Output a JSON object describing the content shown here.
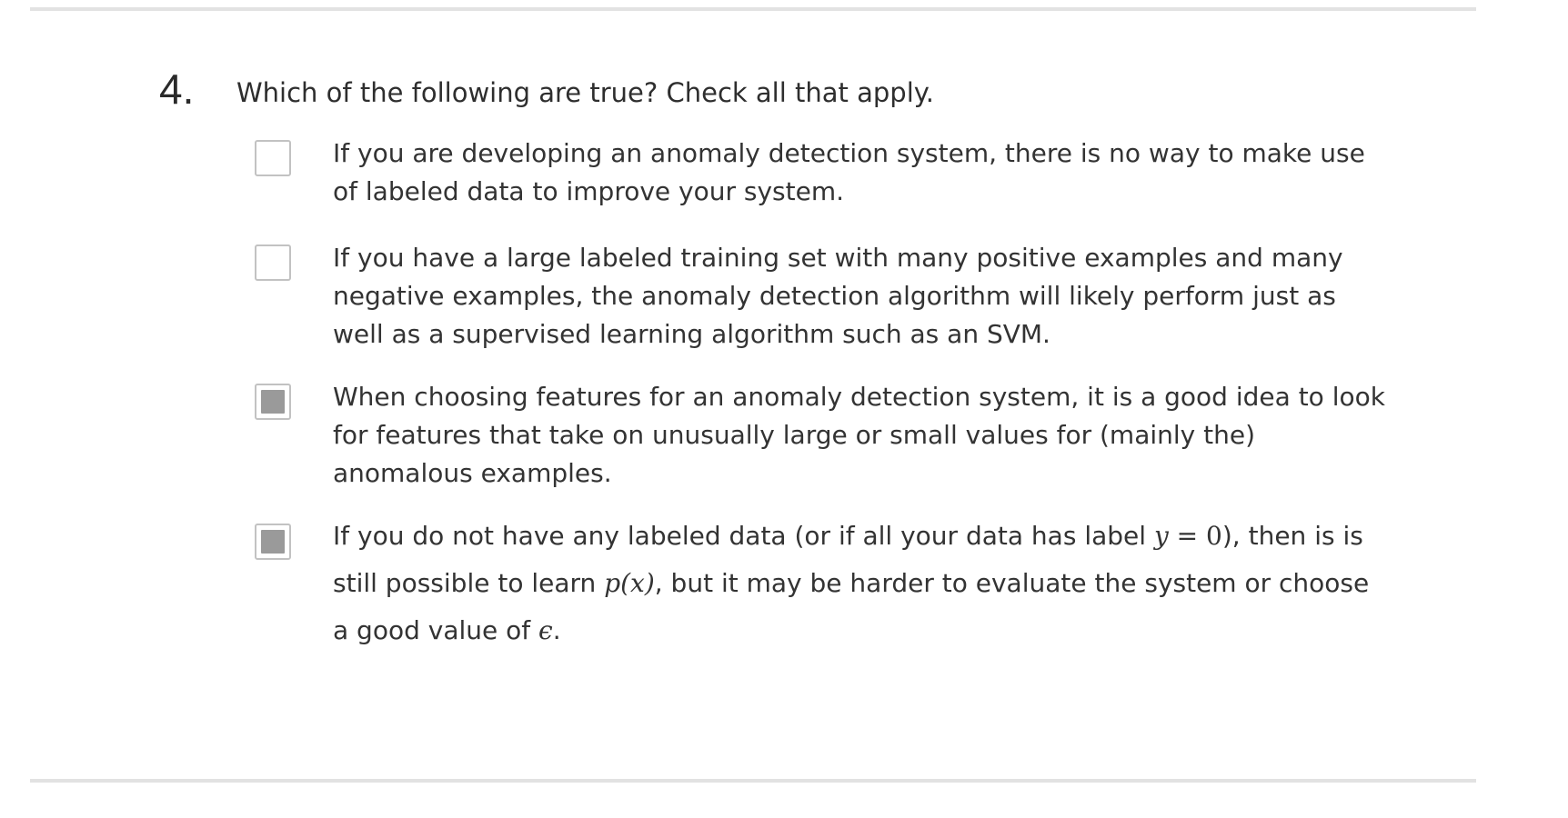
{
  "question": {
    "number": "4.",
    "prompt": "Which of the following are true? Check all that apply."
  },
  "options": [
    {
      "checked": false,
      "text": "If you are developing an anomaly detection system, there is no way to make use of labeled data to improve your system."
    },
    {
      "checked": false,
      "text": "If you have a large labeled training set with many positive examples and many negative examples, the anomaly detection algorithm will likely perform just as well as a supervised learning algorithm such as an SVM."
    },
    {
      "checked": true,
      "text": "When choosing features for an anomaly detection system, it is a good idea to look for features that take on unusually large or small values for (mainly the) anomalous examples."
    },
    {
      "checked": true,
      "parts": {
        "p1": "If you do not have any labeled data (or if all your data has label ",
        "m_y": "y",
        "m_eq": " = ",
        "m_zero": "0",
        "p2": "), then is is still possible to learn ",
        "m_px": "p(x)",
        "p3": ", but it may be harder to evaluate the system or choose a good value of ",
        "m_eps": "ϵ",
        "p4": "."
      }
    }
  ],
  "colors": {
    "rule": "#e2e2e2",
    "checkbox_border": "#c2c2c2",
    "checkbox_fill": "#9a9a9a",
    "text": "#333333"
  }
}
